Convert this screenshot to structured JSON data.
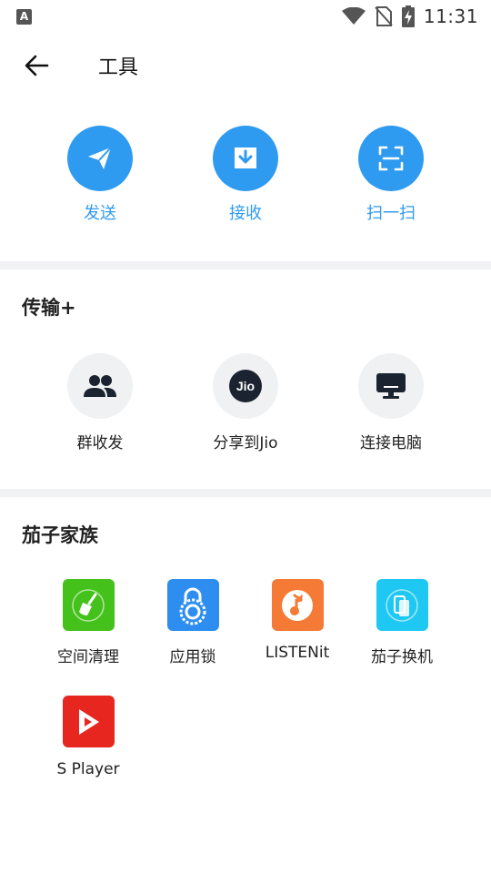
{
  "status_bar": {
    "notification_glyph": "A",
    "time": "11:31",
    "icons": [
      "wifi-icon",
      "no-sim-icon",
      "battery-charging-icon"
    ]
  },
  "app_bar": {
    "back_icon": "arrow-left-icon",
    "title": "工具"
  },
  "top_actions": [
    {
      "label": "发送",
      "icon": "paper-plane-icon"
    },
    {
      "label": "接收",
      "icon": "download-tray-icon"
    },
    {
      "label": "扫一扫",
      "icon": "scan-icon"
    }
  ],
  "transfer_section": {
    "title": "传输+",
    "items": [
      {
        "label": "群收发",
        "icon": "group-icon"
      },
      {
        "label": "分享到Jio",
        "icon": "jio-logo",
        "logo_text": "Jio"
      },
      {
        "label": "连接电脑",
        "icon": "monitor-icon"
      }
    ]
  },
  "family_section": {
    "title": "茄子家族",
    "apps": [
      {
        "label": "空间清理",
        "icon": "broom-icon",
        "color": "#44c11a"
      },
      {
        "label": "应用锁",
        "icon": "padlock-icon",
        "color": "#2e8ef0"
      },
      {
        "label": "LISTENit",
        "icon": "music-note-icon",
        "color": "#f47a35"
      },
      {
        "label": "茄子换机",
        "icon": "phone-swap-icon",
        "color": "#1ec8f2"
      },
      {
        "label": "S Player",
        "icon": "play-icon",
        "color": "#e6261f"
      }
    ]
  },
  "colors": {
    "accent": "#2f9bf0",
    "divider": "#f1f2f4",
    "gray_circle": "#f0f1f3",
    "icon_dark": "#1b2330"
  }
}
